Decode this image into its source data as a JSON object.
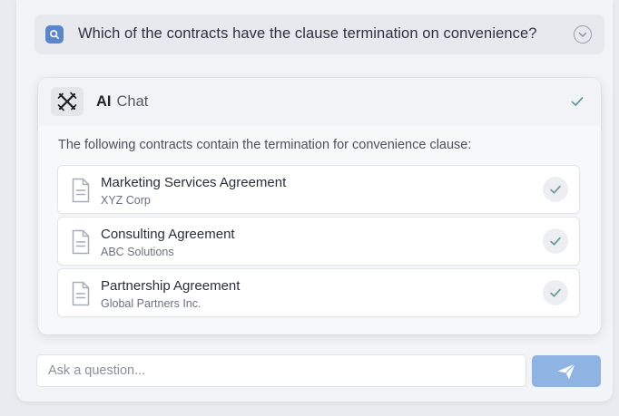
{
  "question": {
    "badge_icon": "search-icon",
    "text": "Which of the contracts have the clause termination on convenience?",
    "toggle_icon": "chevron-down-icon"
  },
  "chat": {
    "logo_icon": "ai-logo-icon",
    "title_bold": "AI",
    "title_rest": "Chat",
    "status_icon": "check-icon",
    "intro": "The following contracts contain the termination for convenience clause:",
    "contracts": [
      {
        "name": "Marketing Services Agreement",
        "party": "XYZ Corp",
        "icon": "document-icon",
        "status_icon": "check-icon"
      },
      {
        "name": "Consulting Agreement",
        "party": "ABC Solutions",
        "icon": "document-icon",
        "status_icon": "check-icon"
      },
      {
        "name": "Partnership Agreement",
        "party": "Global Partners Inc.",
        "icon": "document-icon",
        "status_icon": "check-icon"
      }
    ]
  },
  "composer": {
    "placeholder": "Ask a question...",
    "value": "",
    "send_icon": "send-icon"
  },
  "colors": {
    "accent": "#5b86c9",
    "send_button": "#8fb3e3",
    "check": "#6a9aa0"
  }
}
